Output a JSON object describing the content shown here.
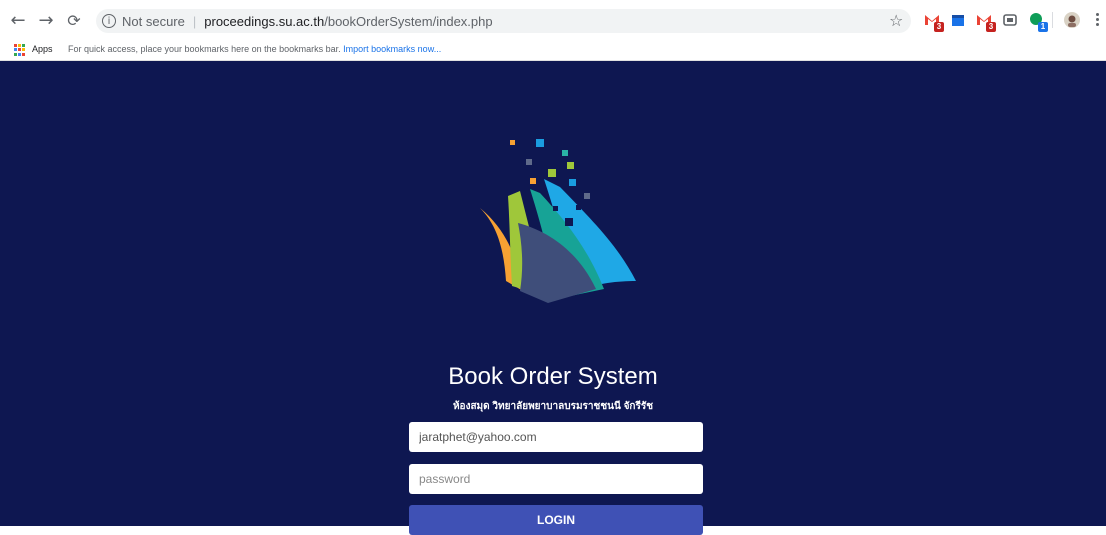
{
  "browser": {
    "url_secure_label": "Not secure",
    "url_host": "proceedings.su.ac.th",
    "url_path": "/bookOrderSystem/index.php",
    "extension_badges": [
      "3",
      "3",
      "1"
    ]
  },
  "bookmarks_bar": {
    "apps_label": "Apps",
    "hint": "For quick access, place your bookmarks here on the bookmarks bar.",
    "import_link": "Import bookmarks now..."
  },
  "login": {
    "title": "Book Order System",
    "subtitle": "ห้องสมุด วิทยาลัยพยาบาลบรมราชชนนี จักรีรัช",
    "email_value": "jaratphet@yahoo.com",
    "password_placeholder": "password",
    "button_label": "LOGIN"
  },
  "colors": {
    "page_background": "#0e1751",
    "button": "#3f51b5"
  }
}
